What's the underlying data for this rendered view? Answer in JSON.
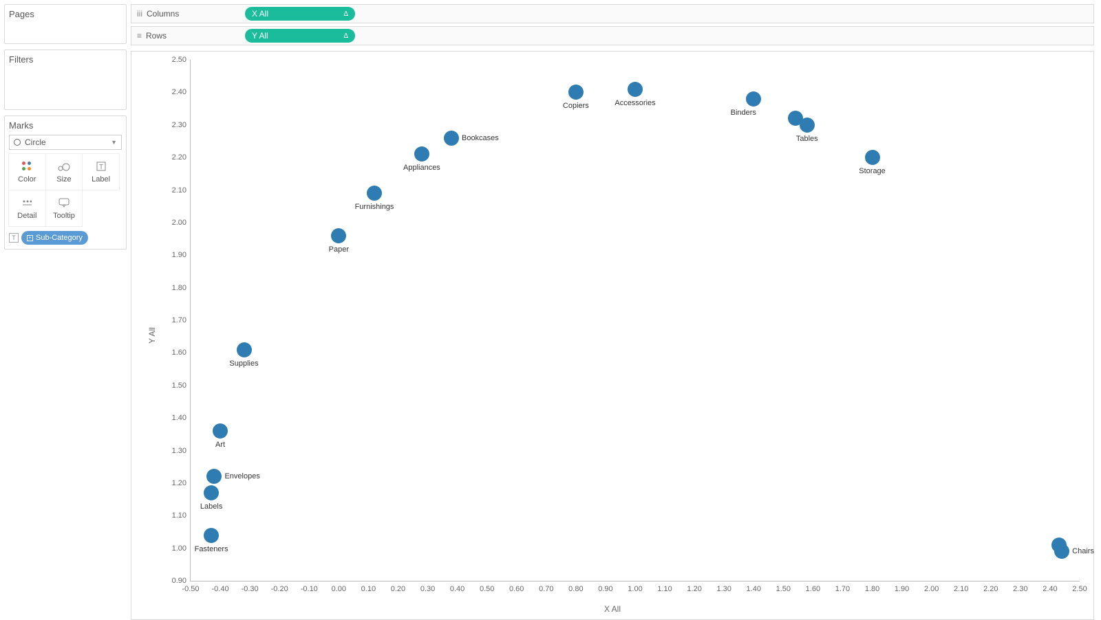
{
  "shelves": {
    "columns_label": "Columns",
    "rows_label": "Rows",
    "columns_pill": "X All",
    "rows_pill": "Y All",
    "delta_glyph": "Δ"
  },
  "cards": {
    "pages": "Pages",
    "filters": "Filters",
    "marks": "Marks"
  },
  "marks": {
    "dropdown": "Circle",
    "buttons": {
      "color": "Color",
      "size": "Size",
      "label": "Label",
      "detail": "Detail",
      "tooltip": "Tooltip"
    },
    "label_pill": "Sub-Category"
  },
  "chart_data": {
    "type": "scatter",
    "xlabel": "X All",
    "ylabel": "Y All",
    "xlim": [
      -0.5,
      2.5
    ],
    "ylim": [
      0.9,
      2.5
    ],
    "xticks": [
      -0.5,
      -0.4,
      -0.3,
      -0.2,
      -0.1,
      0.0,
      0.1,
      0.2,
      0.3,
      0.4,
      0.5,
      0.6,
      0.7,
      0.8,
      0.9,
      1.0,
      1.1,
      1.2,
      1.3,
      1.4,
      1.5,
      1.6,
      1.7,
      1.8,
      1.9,
      2.0,
      2.1,
      2.2,
      2.3,
      2.4,
      2.5
    ],
    "yticks": [
      0.9,
      1.0,
      1.1,
      1.2,
      1.3,
      1.4,
      1.5,
      1.6,
      1.7,
      1.8,
      1.9,
      2.0,
      2.1,
      2.2,
      2.3,
      2.4,
      2.5
    ],
    "points": [
      {
        "label": "Fasteners",
        "x": -0.43,
        "y": 1.04,
        "label_pos": "below"
      },
      {
        "label": "Labels",
        "x": -0.43,
        "y": 1.17,
        "label_pos": "below"
      },
      {
        "label": "Envelopes",
        "x": -0.42,
        "y": 1.22,
        "label_pos": "right"
      },
      {
        "label": "Art",
        "x": -0.4,
        "y": 1.36,
        "label_pos": "below"
      },
      {
        "label": "Supplies",
        "x": -0.32,
        "y": 1.61,
        "label_pos": "below"
      },
      {
        "label": "Paper",
        "x": 0.0,
        "y": 1.96,
        "label_pos": "below"
      },
      {
        "label": "Furnishings",
        "x": 0.12,
        "y": 2.09,
        "label_pos": "below"
      },
      {
        "label": "Appliances",
        "x": 0.28,
        "y": 2.21,
        "label_pos": "below"
      },
      {
        "label": "Bookcases",
        "x": 0.38,
        "y": 2.26,
        "label_pos": "right"
      },
      {
        "label": "Copiers",
        "x": 0.8,
        "y": 2.4,
        "label_pos": "below"
      },
      {
        "label": "Accessories",
        "x": 1.0,
        "y": 2.41,
        "label_pos": "below"
      },
      {
        "label": "Binders",
        "x": 1.4,
        "y": 2.38,
        "label_pos": "belowleft"
      },
      {
        "label": "",
        "x": 1.54,
        "y": 2.32,
        "label_pos": "none"
      },
      {
        "label": "Tables",
        "x": 1.58,
        "y": 2.3,
        "label_pos": "below"
      },
      {
        "label": "Storage",
        "x": 1.8,
        "y": 2.2,
        "label_pos": "below"
      },
      {
        "label": "",
        "x": 2.43,
        "y": 1.01,
        "label_pos": "none"
      },
      {
        "label": "Chairs",
        "x": 2.44,
        "y": 0.99,
        "label_pos": "right"
      }
    ]
  }
}
